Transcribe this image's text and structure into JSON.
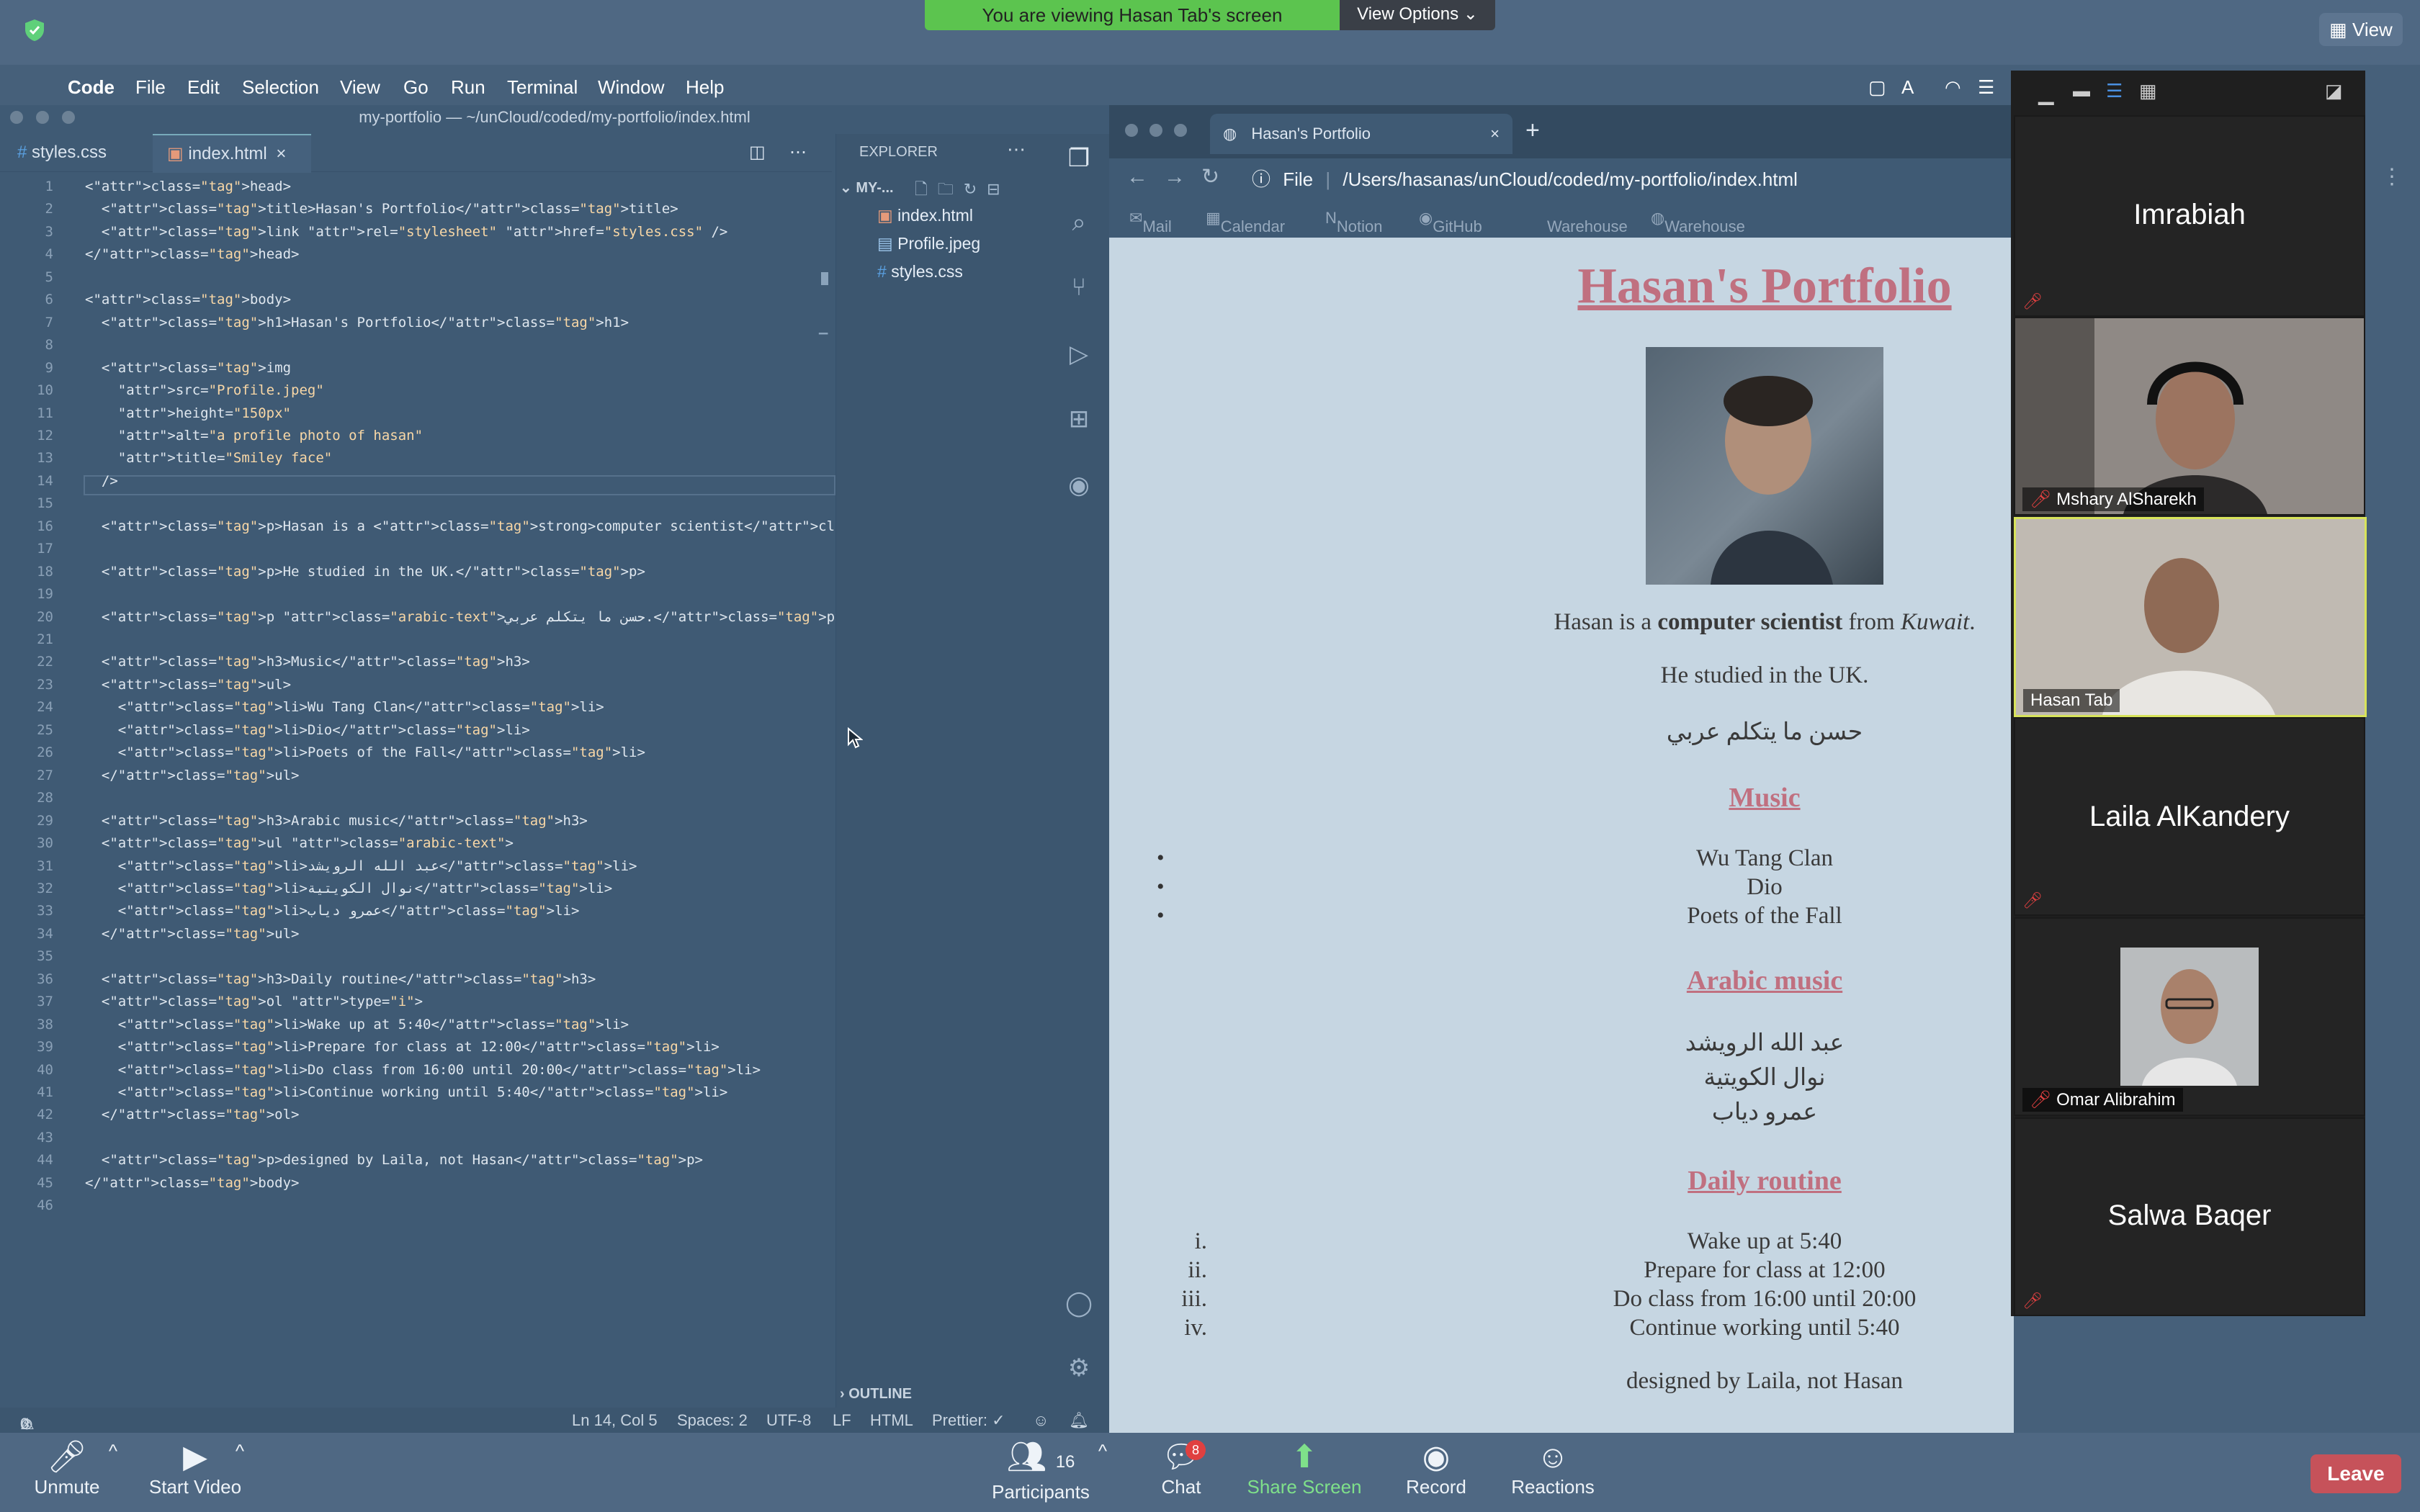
{
  "zoom": {
    "banner": "You are viewing Hasan Tab's screen",
    "view_options": "View Options",
    "view_button": "View",
    "bottom": {
      "unmute": "Unmute",
      "start_video": "Start Video",
      "participants": "Participants",
      "participants_count": "16",
      "chat": "Chat",
      "chat_badge": "8",
      "share_screen": "Share Screen",
      "record": "Record",
      "reactions": "Reactions",
      "leave": "Leave"
    },
    "gallery": {
      "tiles": [
        {
          "name": "Imrabiah"
        },
        {
          "name": "Mshary AlSharekh"
        },
        {
          "name": "Hasan Tab"
        },
        {
          "name": "Laila AlKandery"
        },
        {
          "name": "Omar Alibrahim"
        },
        {
          "name": "Salwa Baqer"
        }
      ]
    }
  },
  "menubar": {
    "items": [
      "Code",
      "File",
      "Edit",
      "Selection",
      "View",
      "Go",
      "Run",
      "Terminal",
      "Window",
      "Help"
    ]
  },
  "vscode": {
    "title": "my-portfolio — ~/unCloud/coded/my-portfolio/index.html",
    "tabs": [
      {
        "label": "styles.css"
      },
      {
        "label": "index.html"
      }
    ],
    "explorer": {
      "title": "EXPLORER",
      "folder": "MY-...",
      "files": [
        "index.html",
        "Profile.jpeg",
        "styles.css"
      ],
      "outline": "OUTLINE"
    },
    "status": {
      "errors": "0",
      "warnings": "0",
      "position": "Ln 14, Col 5",
      "spaces": "Spaces: 2",
      "encoding": "UTF-8",
      "eol": "LF",
      "language": "HTML",
      "formatter": "Prettier: ✓"
    },
    "code_lines": [
      "<head>",
      "  <title>Hasan's Portfolio</title>",
      "  <link rel=\"stylesheet\" href=\"styles.css\" />",
      "</head>",
      "",
      "<body>",
      "  <h1>Hasan's Portfolio</h1>",
      "",
      "  <img",
      "    src=\"Profile.jpeg\"",
      "    height=\"150px\"",
      "    alt=\"a profile photo of hasan\"",
      "    title=\"Smiley face\"",
      "  />",
      "",
      "  <p>Hasan is a <strong>computer scientist</strong> from <i>Kuwait</i>.</p>",
      "",
      "  <p>He studied in the UK.</p>",
      "",
      "  <p class=\"arabic-text\">حسن ما يتكلم عربي.</p>",
      "",
      "  <h3>Music</h3>",
      "  <ul>",
      "    <li>Wu Tang Clan</li>",
      "    <li>Dio</li>",
      "    <li>Poets of the Fall</li>",
      "  </ul>",
      "",
      "  <h3>Arabic music</h3>",
      "  <ul class=\"arabic-text\">",
      "    <li>عبد الله الرويشد</li>",
      "    <li>نوال الكويتية</li>",
      "    <li>عمرو دياب</li>",
      "  </ul>",
      "",
      "  <h3>Daily routine</h3>",
      "  <ol type=\"i\">",
      "    <li>Wake up at 5:40</li>",
      "    <li>Prepare for class at 12:00</li>",
      "    <li>Do class from 16:00 until 20:00</li>",
      "    <li>Continue working until 5:40</li>",
      "  </ol>",
      "",
      "  <p>designed by Laila, not Hasan</p>",
      "</body>",
      ""
    ]
  },
  "browser": {
    "tab_title": "Hasan's Portfolio",
    "url_scheme": "File",
    "url": "/Users/hasanas/unCloud/coded/my-portfolio/index.html",
    "bookmarks": [
      "Mail",
      "Calendar",
      "Notion",
      "GitHub",
      "Warehouse",
      "Warehouse API"
    ]
  },
  "portfolio": {
    "h1": "Hasan's Portfolio",
    "intro_pre": "Hasan is a ",
    "intro_strong": "computer scientist",
    "intro_mid": " from ",
    "intro_em": "Kuwait",
    "intro_post": ".",
    "studied": "He studied in the UK.",
    "arabic_line": "حسن ما يتكلم عربي",
    "music_heading": "Music",
    "music": [
      "Wu Tang Clan",
      "Dio",
      "Poets of the Fall"
    ],
    "arabic_heading": "Arabic music",
    "arabic_music": [
      "عبد الله الرويشد",
      "نوال الكويتية",
      "عمرو دياب"
    ],
    "routine_heading": "Daily routine",
    "routine_markers": [
      "i.",
      "ii.",
      "iii.",
      "iv."
    ],
    "routine": [
      "Wake up at 5:40",
      "Prepare for class at 12:00",
      "Do class from 16:00 until 20:00",
      "Continue working until 5:40"
    ],
    "footer": "designed by Laila, not Hasan"
  }
}
